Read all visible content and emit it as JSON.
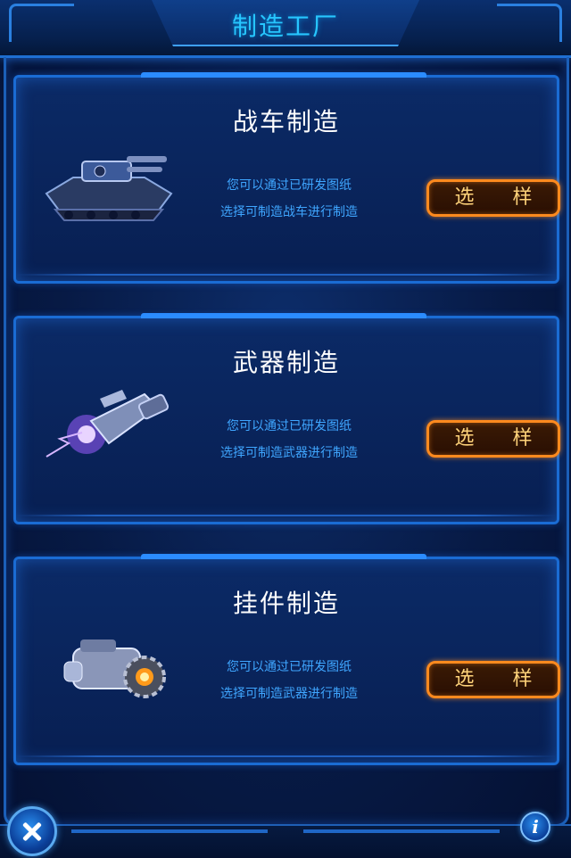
{
  "header": {
    "title": "制造工厂"
  },
  "panels": [
    {
      "title": "战车制造",
      "desc_line1": "您可以通过已研发图纸",
      "desc_line2": "选择可制造战车进行制造",
      "button_label": "选 样",
      "art_icon": "tank-icon"
    },
    {
      "title": "武器制造",
      "desc_line1": "您可以通过已研发图纸",
      "desc_line2": "选择可制造武器进行制造",
      "button_label": "选 样",
      "art_icon": "laser-cannon-icon"
    },
    {
      "title": "挂件制造",
      "desc_line1": "您可以通过已研发图纸",
      "desc_line2": "选择可制造武器进行制造",
      "button_label": "选 样",
      "art_icon": "gear-cannon-icon"
    }
  ],
  "footer": {
    "info_label": "i"
  },
  "colors": {
    "accent_cyan": "#27c6ff",
    "desc_blue": "#3fa6ff",
    "button_orange": "#ff8a1e",
    "button_text": "#ffd37a"
  }
}
